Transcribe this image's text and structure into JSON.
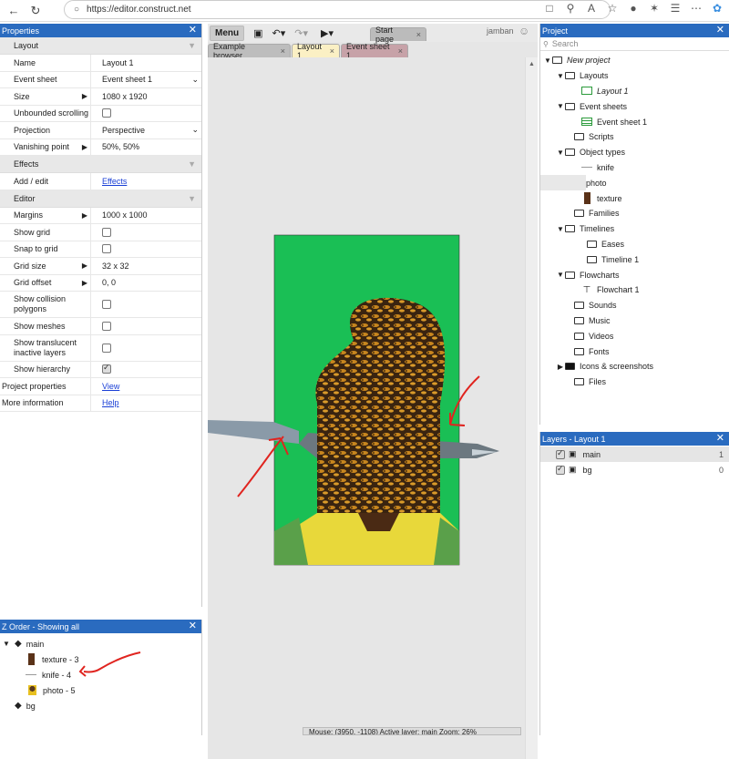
{
  "browser": {
    "url": "https://editor.construct.net"
  },
  "properties": {
    "title": "Properties",
    "sections": {
      "layout": "Layout",
      "effects": "Effects",
      "editor": "Editor"
    },
    "rows": {
      "name": {
        "label": "Name",
        "value": "Layout 1"
      },
      "event_sheet": {
        "label": "Event sheet",
        "value": "Event sheet 1"
      },
      "size": {
        "label": "Size",
        "value": "1080 x 1920"
      },
      "unbounded": {
        "label": "Unbounded scrolling"
      },
      "projection": {
        "label": "Projection",
        "value": "Perspective"
      },
      "vanishing": {
        "label": "Vanishing point",
        "value": "50%, 50%"
      },
      "add_edit": {
        "label": "Add / edit",
        "value": "Effects"
      },
      "margins": {
        "label": "Margins",
        "value": "1000 x 1000"
      },
      "show_grid": {
        "label": "Show grid"
      },
      "snap_grid": {
        "label": "Snap to grid"
      },
      "grid_size": {
        "label": "Grid size",
        "value": "32 x 32"
      },
      "grid_offset": {
        "label": "Grid offset",
        "value": "0, 0"
      },
      "collision": {
        "label": "Show collision polygons"
      },
      "meshes": {
        "label": "Show meshes"
      },
      "translucent": {
        "label": "Show translucent inactive layers"
      },
      "hierarchy": {
        "label": "Show hierarchy"
      },
      "project_props": {
        "label": "Project properties",
        "value": "View"
      },
      "more_info": {
        "label": "More information",
        "value": "Help"
      }
    }
  },
  "zorder": {
    "title": "Z Order - Showing all",
    "items": [
      "main",
      "texture - 3",
      "knife - 4",
      "photo - 5",
      "bg"
    ]
  },
  "toolbar": {
    "menu": "Menu",
    "user": "jamban"
  },
  "tabs": {
    "start": "Start page",
    "example": "Example browser",
    "layout": "Layout 1",
    "event": "Event sheet 1"
  },
  "status": "Mouse: (3950, -1108)     Active layer: main     Zoom: 26%",
  "project": {
    "title": "Project",
    "search_placeholder": "Search",
    "tree": {
      "root": "New project",
      "layouts": "Layouts",
      "layout1": "Layout 1",
      "event_sheets": "Event sheets",
      "event1": "Event sheet 1",
      "scripts": "Scripts",
      "object_types": "Object types",
      "knife": "knife",
      "photo": "photo",
      "texture": "texture",
      "families": "Families",
      "timelines": "Timelines",
      "eases": "Eases",
      "timeline1": "Timeline 1",
      "flowcharts": "Flowcharts",
      "flowchart1": "Flowchart 1",
      "sounds": "Sounds",
      "music": "Music",
      "videos": "Videos",
      "fonts": "Fonts",
      "icons": "Icons & screenshots",
      "files": "Files"
    }
  },
  "layers": {
    "title": "Layers - Layout 1",
    "items": [
      {
        "name": "main",
        "num": "1"
      },
      {
        "name": "bg",
        "num": "0"
      }
    ]
  },
  "colors": {
    "panel_header": "#2a6bbf",
    "layout_bg": "#1abf55",
    "annotation": "#e0241f"
  }
}
